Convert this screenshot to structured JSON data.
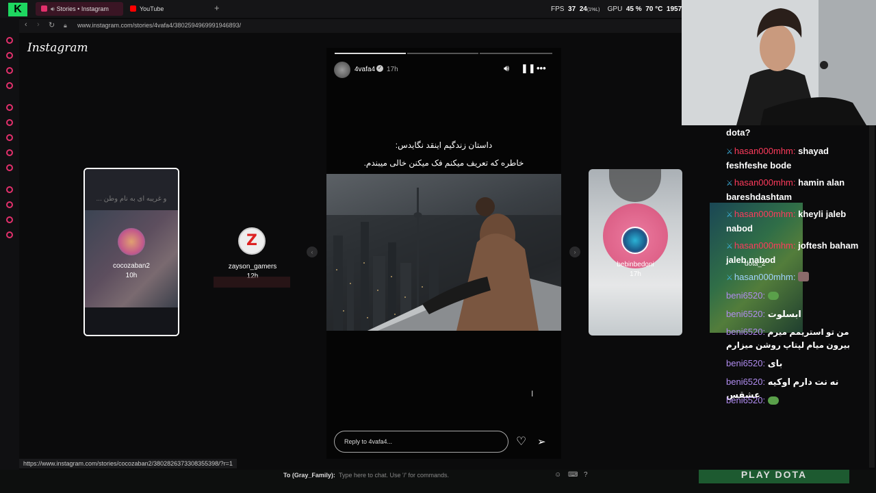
{
  "browser": {
    "tabs": [
      {
        "label": "Stories • Instagram",
        "active": true,
        "color": "#e3306c"
      },
      {
        "label": "YouTube",
        "active": false,
        "color": "#ff0000"
      }
    ],
    "new_tab_label": "+",
    "address": "www.instagram.com/stories/4vafa4/3802594969991946893/",
    "hover_url": "https://www.instagram.com/stories/cocozaban2/3802826373308355398/?r=1"
  },
  "overlay_perf": {
    "fps_label": "FPS",
    "fps_value": "37",
    "fps_low": "24",
    "fps_low_pct": "(1%L)",
    "gpu_label": "GPU",
    "gpu_value": "45 %",
    "gpu_temp": "70 °C",
    "gpu_clock": "1957"
  },
  "instagram": {
    "logo": "Instagram",
    "left_story": {
      "username": "cocozaban2",
      "time": "10h",
      "teaser": "و غریبه ای به نام وطن ..."
    },
    "mid_story": {
      "username": "zayson_gamers",
      "time": "12h"
    },
    "right_story": {
      "username": "bebinbedoni",
      "time": "17h"
    },
    "main_story": {
      "username": "4vafa4",
      "time": "17h",
      "caption_line1": "داستان زندگیم اینقد نگایدس:",
      "caption_line2": "خاطره که تعریف میکنم فک میکنن خالی میبندم.",
      "reply_placeholder": "Reply to 4vafa4..."
    },
    "icons": {
      "mute": "speaker-icon",
      "pause": "pause-icon",
      "more": "more-icon",
      "heart": "heart-icon",
      "send": "send-icon"
    }
  },
  "game": {
    "chat_to": "To (Gray_Family):",
    "chat_placeholder": "Type here to chat. Use '/' for commands.",
    "play_button": "PLAY DOTA"
  },
  "chat": {
    "messages": [
      {
        "user": "",
        "text": "dota?",
        "color": "#ffffff"
      },
      {
        "user": "hasan000mhm:",
        "text": "shayad feshfeshe bode",
        "color": "#ff3b5c"
      },
      {
        "user": "hasan000mhm:",
        "text": "hamin alan bareshdashtam",
        "color": "#ff3b5c"
      },
      {
        "user": "hasan000mhm:",
        "text": "kheyli jaleb nabod",
        "color": "#ff3b5c"
      },
      {
        "user": "hasan000mhm:",
        "text": "joftesh baham jaleb nabod",
        "color": "#ff3b5c"
      },
      {
        "user": "hasan000mhm:",
        "text": "",
        "color": "#ff3b5c"
      },
      {
        "user": "beni6520:",
        "text": "",
        "color": "#b08cf0"
      },
      {
        "user": "beni6520:",
        "text": "ابسلوت",
        "color": "#b08cf0"
      },
      {
        "user": "beni6520:",
        "text": "من تو استریمم میرم بیرون میام لپتاپ روشن میزارم",
        "color": "#b08cf0"
      },
      {
        "user": "beni6520:",
        "text": "بای",
        "color": "#b08cf0"
      },
      {
        "user": "beni6520:",
        "text": "نه نت دارم اوکیه عشقس",
        "color": "#b08cf0"
      },
      {
        "user": "beni6520:",
        "text": "",
        "color": "#b08cf0"
      }
    ],
    "overlay_label": "dota_2"
  }
}
